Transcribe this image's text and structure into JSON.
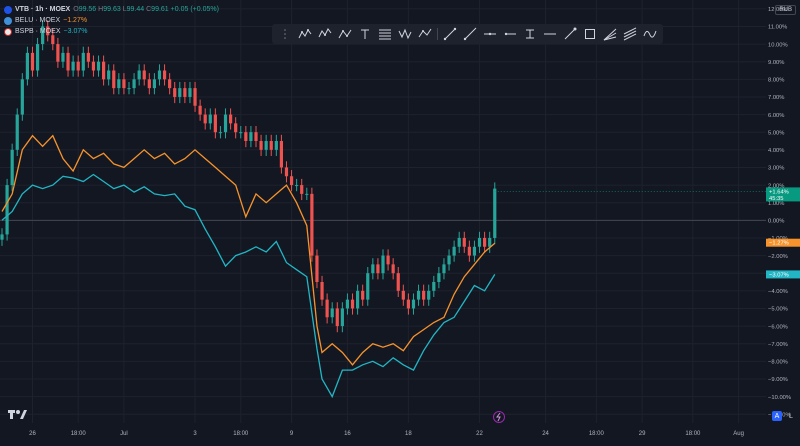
{
  "legend": {
    "symbol": "VTB · 1h · MOEX",
    "ohlc": [
      {
        "k": "O",
        "v": "99.56"
      },
      {
        "k": "H",
        "v": "99.63"
      },
      {
        "k": "L",
        "v": "99.44"
      },
      {
        "k": "C",
        "v": "99.61"
      }
    ],
    "change": "+0.05 (+0.05%)",
    "comparisons": [
      {
        "label": "BELU · MOEX",
        "value": "−1.27%",
        "color": "#f7932c"
      },
      {
        "label": "BSPB · MOEX",
        "value": "−3.07%",
        "color": "#22b6c5"
      }
    ]
  },
  "currency": "RUB",
  "scale_buttons": {
    "auto": "A",
    "log": "L"
  },
  "toolbar": {
    "icons": [
      "trend-pattern-icon",
      "elliott-wave-icon",
      "abcd-pattern-icon",
      "text-icon",
      "fib-retracement-icon",
      "xabcd-pattern-icon",
      "projection-icon",
      "trend-line-icon",
      "ray-icon",
      "horizontal-line-icon",
      "horizontal-segment-icon",
      "info-line-icon",
      "arrow-icon",
      "rectangle-icon",
      "fib-fan-icon",
      "parallel-channel-icon",
      "brush-icon"
    ]
  },
  "chart_data": {
    "type": "line",
    "yaxis": {
      "unit": "%",
      "ylim": [
        -11.5,
        12.5
      ],
      "ticks": [
        "12.00%",
        "11.00%",
        "10.00%",
        "9.00%",
        "8.00%",
        "7.00%",
        "6.00%",
        "5.00%",
        "4.00%",
        "3.00%",
        "2.00%",
        "1.00%",
        "0.00%",
        "−1.00%",
        "−2.00%",
        "−3.00%",
        "−4.00%",
        "−5.00%",
        "−6.00%",
        "−7.00%",
        "−8.00%",
        "−9.00%",
        "−10.00%",
        "−11.00%"
      ],
      "tick_values": [
        12,
        11,
        10,
        9,
        8,
        7,
        6,
        5,
        4,
        3,
        2,
        1,
        0,
        -1,
        -2,
        -3,
        -4,
        -5,
        -6,
        -7,
        -8,
        -9,
        -10,
        -11
      ]
    },
    "xaxis": {
      "ticks": [
        "26",
        "18:00",
        "Jul",
        "3",
        "18:00",
        "9",
        "16",
        "18",
        "22",
        "24",
        "18:00",
        "29",
        "18:00",
        "Aug"
      ]
    },
    "x_range": [
      0,
      150
    ],
    "tick_x": [
      6,
      15,
      24,
      38,
      47,
      57,
      68,
      80,
      94,
      107,
      117,
      126,
      136,
      145
    ],
    "series": [
      {
        "name": "VTB",
        "kind": "candles",
        "color_up": "#26a69a",
        "color_down": "#ef5350",
        "values": [
          [
            0,
            -0.8
          ],
          [
            1,
            2
          ],
          [
            2,
            4
          ],
          [
            3,
            6
          ],
          [
            4,
            8
          ],
          [
            5,
            9.5
          ],
          [
            6,
            8.5
          ],
          [
            7,
            10
          ],
          [
            8,
            11
          ],
          [
            9,
            10.5
          ],
          [
            10,
            10
          ],
          [
            11,
            9
          ],
          [
            12,
            9.5
          ],
          [
            13,
            8.5
          ],
          [
            14,
            9
          ],
          [
            15,
            8.5
          ],
          [
            16,
            9.5
          ],
          [
            17,
            9
          ],
          [
            18,
            8.5
          ],
          [
            19,
            9
          ],
          [
            20,
            8
          ],
          [
            21,
            8.5
          ],
          [
            22,
            7.5
          ],
          [
            23,
            8
          ],
          [
            24,
            7.5
          ],
          [
            25,
            7.5
          ],
          [
            26,
            8
          ],
          [
            27,
            8.5
          ],
          [
            28,
            8
          ],
          [
            29,
            7.5
          ],
          [
            30,
            8
          ],
          [
            31,
            8.5
          ],
          [
            32,
            8
          ],
          [
            33,
            7.5
          ],
          [
            34,
            7
          ],
          [
            35,
            7.5
          ],
          [
            36,
            7
          ],
          [
            37,
            7.5
          ],
          [
            38,
            6.5
          ],
          [
            39,
            6
          ],
          [
            40,
            5.5
          ],
          [
            41,
            6
          ],
          [
            42,
            5
          ],
          [
            43,
            5
          ],
          [
            44,
            6
          ],
          [
            45,
            5.5
          ],
          [
            46,
            5
          ],
          [
            47,
            5
          ],
          [
            48,
            4.5
          ],
          [
            49,
            5
          ],
          [
            50,
            4.5
          ],
          [
            51,
            4
          ],
          [
            52,
            4.5
          ],
          [
            53,
            4
          ],
          [
            54,
            4.5
          ],
          [
            55,
            3
          ],
          [
            56,
            2.5
          ],
          [
            57,
            2
          ],
          [
            58,
            2
          ],
          [
            59,
            1.5
          ],
          [
            60,
            1.5
          ],
          [
            61,
            -2
          ],
          [
            62,
            -3.5
          ],
          [
            63,
            -4.5
          ],
          [
            64,
            -5.5
          ],
          [
            65,
            -5
          ],
          [
            66,
            -6
          ],
          [
            67,
            -5
          ],
          [
            68,
            -4.5
          ],
          [
            69,
            -5
          ],
          [
            70,
            -4
          ],
          [
            71,
            -4.5
          ],
          [
            72,
            -3
          ],
          [
            73,
            -2.5
          ],
          [
            74,
            -3
          ],
          [
            75,
            -2
          ],
          [
            76,
            -2.5
          ],
          [
            77,
            -3
          ],
          [
            78,
            -4
          ],
          [
            79,
            -4.5
          ],
          [
            80,
            -5
          ],
          [
            81,
            -4.5
          ],
          [
            82,
            -4
          ],
          [
            83,
            -4.5
          ],
          [
            84,
            -4
          ],
          [
            85,
            -3.5
          ],
          [
            86,
            -3
          ],
          [
            87,
            -2.5
          ],
          [
            88,
            -2
          ],
          [
            89,
            -1.5
          ],
          [
            90,
            -1
          ],
          [
            91,
            -1.5
          ],
          [
            92,
            -2
          ],
          [
            93,
            -1.5
          ],
          [
            94,
            -1
          ],
          [
            95,
            -1.5
          ],
          [
            96,
            -1
          ],
          [
            97,
            1.8
          ]
        ]
      },
      {
        "name": "BELU",
        "kind": "line",
        "color": "#f7932c",
        "values": [
          [
            0,
            0.5
          ],
          [
            2,
            1.5
          ],
          [
            4,
            4
          ],
          [
            6,
            4.8
          ],
          [
            8,
            4.2
          ],
          [
            10,
            4.8
          ],
          [
            12,
            3.5
          ],
          [
            14,
            2.8
          ],
          [
            16,
            4
          ],
          [
            18,
            3.5
          ],
          [
            20,
            3.8
          ],
          [
            22,
            3.2
          ],
          [
            24,
            3
          ],
          [
            26,
            3.5
          ],
          [
            28,
            4
          ],
          [
            30,
            3.5
          ],
          [
            32,
            3.8
          ],
          [
            34,
            3.2
          ],
          [
            36,
            3.5
          ],
          [
            38,
            4
          ],
          [
            40,
            3.5
          ],
          [
            42,
            3
          ],
          [
            44,
            2.5
          ],
          [
            46,
            2
          ],
          [
            48,
            0.2
          ],
          [
            50,
            1.5
          ],
          [
            52,
            1
          ],
          [
            54,
            1.5
          ],
          [
            56,
            2
          ],
          [
            58,
            1
          ],
          [
            60,
            -0.3
          ],
          [
            62,
            -6
          ],
          [
            63,
            -7.5
          ],
          [
            65,
            -7
          ],
          [
            67,
            -7.5
          ],
          [
            69,
            -8.2
          ],
          [
            71,
            -7.5
          ],
          [
            73,
            -7
          ],
          [
            75,
            -7.2
          ],
          [
            77,
            -7
          ],
          [
            79,
            -7.4
          ],
          [
            81,
            -6.6
          ],
          [
            83,
            -6.2
          ],
          [
            85,
            -5.8
          ],
          [
            87,
            -5.5
          ],
          [
            89,
            -4.2
          ],
          [
            91,
            -3.2
          ],
          [
            93,
            -2.5
          ],
          [
            95,
            -1.8
          ],
          [
            97,
            -1.3
          ]
        ]
      },
      {
        "name": "BSPB",
        "kind": "line",
        "color": "#22b6c5",
        "values": [
          [
            0,
            0
          ],
          [
            2,
            0.5
          ],
          [
            4,
            1.5
          ],
          [
            6,
            2
          ],
          [
            8,
            1.8
          ],
          [
            10,
            2
          ],
          [
            12,
            2.5
          ],
          [
            14,
            2.4
          ],
          [
            16,
            2.2
          ],
          [
            18,
            2.6
          ],
          [
            20,
            2.2
          ],
          [
            22,
            1.8
          ],
          [
            24,
            2
          ],
          [
            26,
            1.6
          ],
          [
            28,
            1.9
          ],
          [
            30,
            1.5
          ],
          [
            32,
            1.4
          ],
          [
            34,
            1.5
          ],
          [
            36,
            0.8
          ],
          [
            38,
            0.6
          ],
          [
            40,
            -0.5
          ],
          [
            42,
            -1.5
          ],
          [
            44,
            -2.6
          ],
          [
            46,
            -2
          ],
          [
            48,
            -1.8
          ],
          [
            50,
            -1.5
          ],
          [
            52,
            -1.8
          ],
          [
            54,
            -1.2
          ],
          [
            56,
            -2.4
          ],
          [
            58,
            -2.8
          ],
          [
            60,
            -3.2
          ],
          [
            62,
            -7.3
          ],
          [
            63,
            -9
          ],
          [
            65,
            -10
          ],
          [
            67,
            -8.5
          ],
          [
            69,
            -8.5
          ],
          [
            71,
            -8.2
          ],
          [
            73,
            -8
          ],
          [
            75,
            -8.3
          ],
          [
            77,
            -7.8
          ],
          [
            79,
            -8.2
          ],
          [
            81,
            -8.5
          ],
          [
            83,
            -7.4
          ],
          [
            85,
            -6.5
          ],
          [
            87,
            -5.8
          ],
          [
            89,
            -5.5
          ],
          [
            91,
            -4.6
          ],
          [
            93,
            -3.7
          ],
          [
            95,
            -4
          ],
          [
            97,
            -3.07
          ]
        ]
      }
    ],
    "price_labels": [
      {
        "series": "VTB",
        "text": "+1.64%",
        "sub": "45:35",
        "value": 1.64,
        "color": "#089981"
      },
      {
        "series": "BELU",
        "text": "−1.27%",
        "value": -1.27,
        "color": "#f7932c"
      },
      {
        "series": "BSPB",
        "text": "−3.07%",
        "value": -3.07,
        "color": "#22b6c5"
      }
    ],
    "zero_line": 0,
    "grid": true,
    "legend_placement": "top-left"
  }
}
